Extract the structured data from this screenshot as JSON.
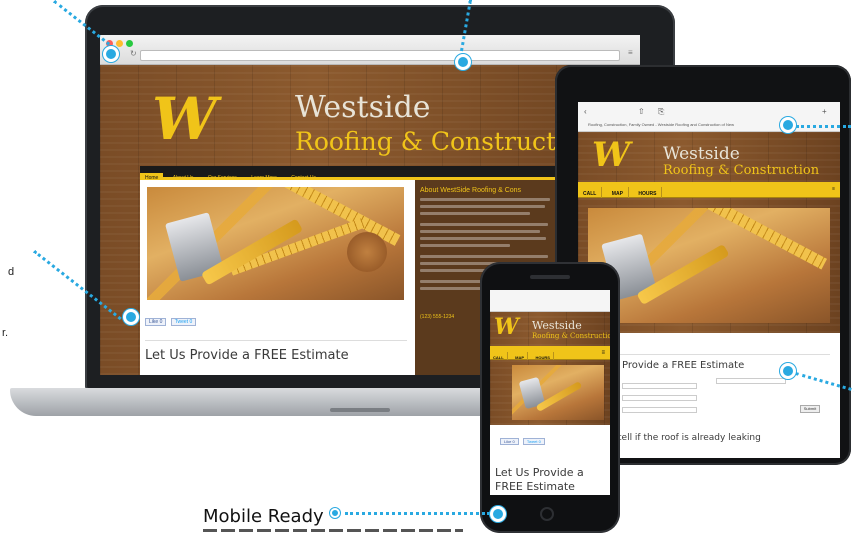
{
  "colors": {
    "callout": "#29a9e1",
    "brand_gold": "#f0c419",
    "wood_brown": "#7a4c26",
    "nav_dark": "#1a1a1a"
  },
  "site": {
    "brand_line1": "Westside",
    "brand_line2_laptop": "Roofing & Construct",
    "brand_line2": "Roofing & Construction",
    "nav": [
      "Home",
      "About Us",
      "Our Services",
      "Learn More",
      "Contact Us"
    ],
    "about_title": "About WestSide Roofing & Cons",
    "estimate_heading": "Let Us Provide a FREE Estimate",
    "like_label": "Like",
    "like_count": "0",
    "tweet_label": "Tweet",
    "tweet_count": "0",
    "footer_phone": "(123) 555-1234",
    "callbar": [
      "CALL",
      "MAP",
      "HOURS"
    ],
    "tablet_tab_title": "Roofing, Construction, Family Owned - Westside Roofing and Construction of New",
    "tablet_estimate": "Provide a FREE Estimate",
    "tablet_leak_text": "tell if the roof is already leaking",
    "tablet_submit": "Submit",
    "phone_estimate_line1": "Let Us Provide a",
    "phone_estimate_line2": "FREE Estimate"
  },
  "callouts": {
    "mobile_label": "Mobile Ready"
  },
  "side_text": {
    "left_top": "d",
    "left_bottom": "r."
  }
}
